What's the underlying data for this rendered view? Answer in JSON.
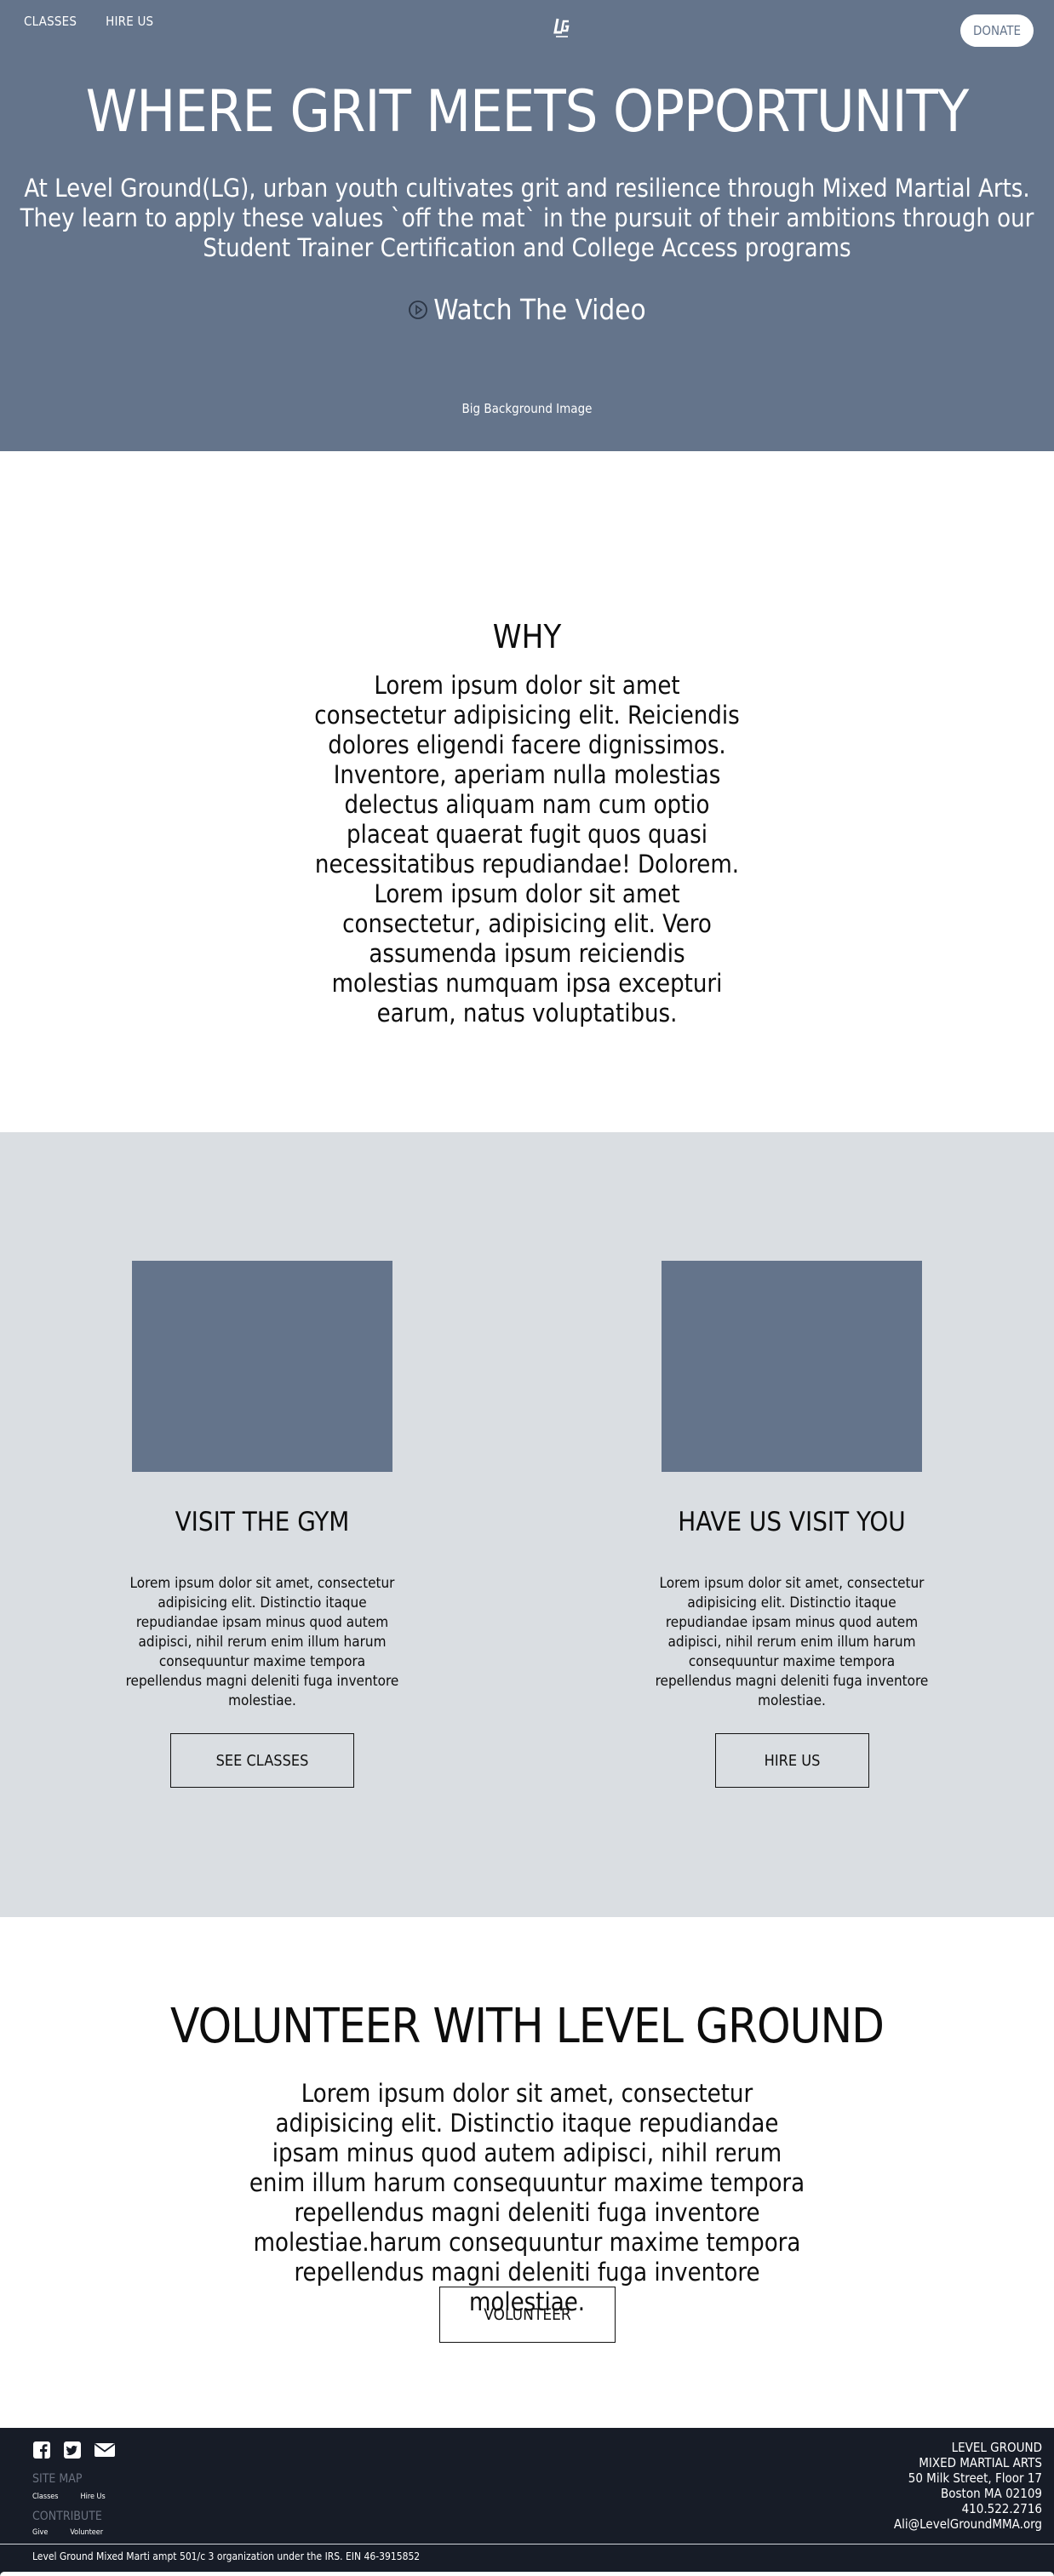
{
  "nav": {
    "links": [
      "CLASSES",
      "HIRE US"
    ],
    "logo_text": "LG",
    "donate_label": "DONATE"
  },
  "hero": {
    "title": "WHERE GRIT MEETS OPPORTUNITY",
    "subtitle": "At Level Ground(LG), urban youth cultivates grit and resilience through Mixed Martial Arts. They learn to apply these values `off the mat` in the pursuit of their ambitions through our Student Trainer Certification and College Access programs",
    "watch_label": "Watch The Video",
    "bg_caption": "Big Background Image"
  },
  "why": {
    "title": "WHY",
    "body": "Lorem ipsum dolor sit amet consectetur adipisicing elit. Reiciendis dolores eligendi facere dignissimos. Inventore, aperiam nulla molestias delectus aliquam nam cum optio placeat quaerat fugit quos quasi necessitatibus repudiandae! Dolorem. Lorem ipsum dolor sit amet consectetur, adipisicing elit. Vero assumenda ipsum reiciendis molestias numquam ipsa excepturi earum, natus voluptatibus."
  },
  "cards": [
    {
      "title": "VISIT THE GYM",
      "text": "Lorem ipsum dolor sit amet, consectetur adipisicing elit. Distinctio itaque repudiandae ipsam minus quod autem adipisci, nihil rerum enim illum harum consequuntur maxime tempora repellendus magni deleniti fuga inventore molestiae.",
      "button": "SEE CLASSES"
    },
    {
      "title": "HAVE US VISIT YOU",
      "text": "Lorem ipsum dolor sit amet, consectetur adipisicing elit. Distinctio itaque repudiandae ipsam minus quod autem adipisci, nihil rerum enim illum harum consequuntur maxime tempora repellendus magni deleniti fuga inventore molestiae.",
      "button": "HIRE US"
    }
  ],
  "volunteer": {
    "title": "VOLUNTEER WITH LEVEL GROUND",
    "body": "Lorem ipsum dolor sit amet, consectetur adipisicing elit. Distinctio itaque repudiandae ipsam minus quod autem adipisci, nihil rerum enim illum harum consequuntur maxime tempora repellendus magni deleniti fuga inventore molestiae.harum consequuntur maxime tempora repellendus magni deleniti fuga inventore molestiae.",
    "button": "VOLUNTEER"
  },
  "footer": {
    "social_icons": [
      "facebook-icon",
      "twitter-icon",
      "envelope-icon"
    ],
    "site_map_heading": "SITE MAP",
    "site_map_links": [
      "Classes",
      "Hire Us"
    ],
    "contribute_heading": "CONTRIBUTE",
    "contribute_links": [
      "Give",
      "Volunteer"
    ],
    "address": [
      "LEVEL GROUND",
      "MIXED MARTIAL ARTS",
      "50 Milk Street, Floor 17",
      "Boston MA 02109",
      "410.522.2716",
      "Ali@LevelGroundMMA.org"
    ],
    "legal": "Level Ground Mixed Marti ampt 501/c 3 organization under the IRS. EIN 46-3915852"
  },
  "colors": {
    "hero_bg": "#64748b",
    "cards_bg": "#dadee2",
    "footer_bg": "#171c27",
    "card_image": "#64748b"
  }
}
